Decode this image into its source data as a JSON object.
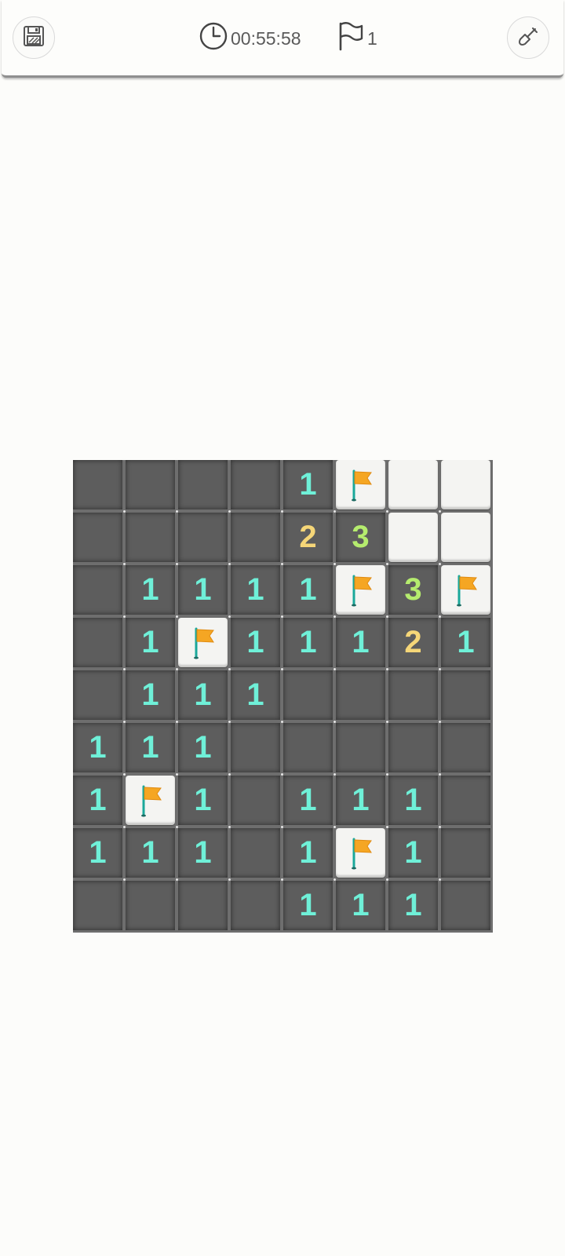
{
  "header": {
    "timer": "00:55:58",
    "flag_count": "1"
  },
  "colors": {
    "n1": "#6ff0d8",
    "n2": "#f5d678",
    "n3": "#b5ec6e",
    "flag": "#f5a623",
    "pole": "#1aa89a"
  },
  "board": {
    "rows": 9,
    "cols": 8,
    "cells": [
      [
        "",
        "",
        "",
        "",
        "1",
        "F",
        "C",
        "C"
      ],
      [
        "",
        "",
        "",
        "",
        "2",
        "3",
        "C",
        "C"
      ],
      [
        "",
        "1",
        "1",
        "1",
        "1",
        "F",
        "3",
        "F"
      ],
      [
        "",
        "1",
        "F",
        "1",
        "1",
        "1",
        "2",
        "1"
      ],
      [
        "",
        "1",
        "1",
        "1",
        "",
        "",
        "",
        ""
      ],
      [
        "1",
        "1",
        "1",
        "",
        "",
        "",
        "",
        ""
      ],
      [
        "1",
        "F",
        "1",
        "",
        "1",
        "1",
        "1",
        ""
      ],
      [
        "1",
        "1",
        "1",
        "",
        "1",
        "F",
        "1",
        ""
      ],
      [
        "",
        "",
        "",
        "",
        "1",
        "1",
        "1",
        ""
      ]
    ]
  }
}
